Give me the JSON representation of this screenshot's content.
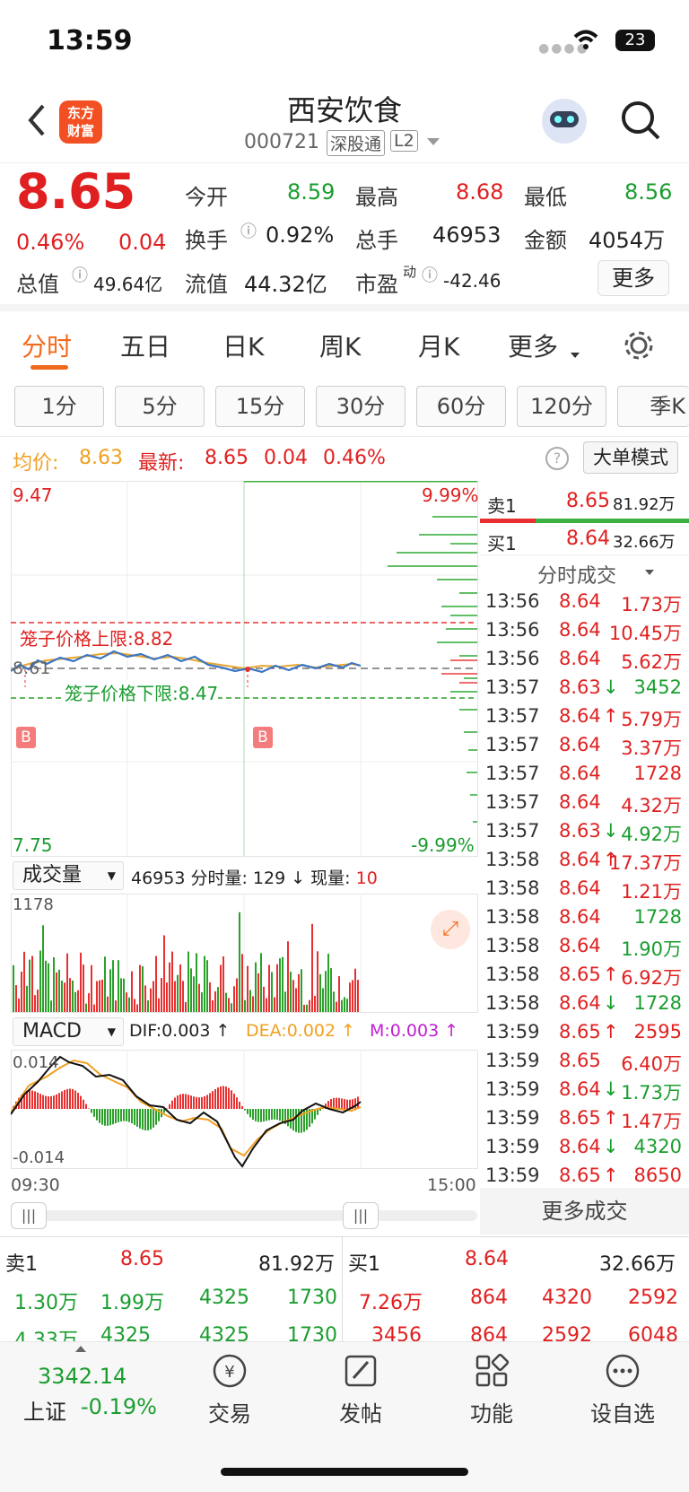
{
  "status": {
    "time": "13:59",
    "battery": "23"
  },
  "header": {
    "title": "西安饮食",
    "code": "000721",
    "tag1": "深股通",
    "tag2": "L2",
    "brand": "东方\n财富"
  },
  "quote": {
    "price": "8.65",
    "pct": "0.46%",
    "chg": "0.04",
    "open_l": "今开",
    "open": "8.59",
    "high_l": "最高",
    "high": "8.68",
    "low_l": "最低",
    "low": "8.56",
    "turn_l": "换手",
    "turn": "0.92%",
    "vol_l": "总手",
    "vol": "46953",
    "amt_l": "金额",
    "amt": "4054万",
    "mcap_l": "总值",
    "mcap": "49.64亿",
    "float_l": "流值",
    "float": "44.32亿",
    "pe_l": "市盈",
    "pe_sup": "动",
    "pe": "-42.46",
    "more": "更多"
  },
  "tabs": [
    "分时",
    "五日",
    "日K",
    "周K",
    "月K",
    "更多"
  ],
  "subtabs": [
    "1分",
    "5分",
    "15分",
    "30分",
    "60分",
    "120分",
    "季K"
  ],
  "info": {
    "avg_l": "均价:",
    "avg": "8.63",
    "new_l": "最新:",
    "new": "8.65",
    "chg": "0.04",
    "pct": "0.46%",
    "mode": "大单模式"
  },
  "chart": {
    "ymax": "9.47",
    "ymin": "7.75",
    "pmax": "9.99%",
    "pmin": "-9.99%",
    "upper": "笼子价格上限:8.82",
    "lower": "笼子价格下限:8.47",
    "ref": "8.61",
    "b": "B",
    "vol_sel": "成交量",
    "vol_info_a": "46953 分时量: 129 ↓ 现量:",
    "vol_info_b": "10",
    "vol_max": "1178",
    "macd_sel": "MACD",
    "dif": "DIF:0.003 ↑",
    "dea": "DEA:0.002 ↑",
    "m": "M:0.003 ↑",
    "mmax": "0.014",
    "mmin": "-0.014",
    "t0": "09:30",
    "t1": "15:00"
  },
  "side": {
    "sell1_l": "卖1",
    "sell1_p": "8.65",
    "sell1_v": "81.92万",
    "buy1_l": "买1",
    "buy1_p": "8.64",
    "buy1_v": "32.66万",
    "header": "分时成交",
    "more": "更多成交",
    "trades": [
      [
        "13:56",
        "8.64",
        "",
        "1.73万",
        "r"
      ],
      [
        "13:56",
        "8.64",
        "",
        "10.45万",
        "r"
      ],
      [
        "13:56",
        "8.64",
        "",
        "5.62万",
        "r"
      ],
      [
        "13:57",
        "8.63",
        "↓",
        "3452",
        "g"
      ],
      [
        "13:57",
        "8.64",
        "↑",
        "5.79万",
        "r"
      ],
      [
        "13:57",
        "8.64",
        "",
        "3.37万",
        "r"
      ],
      [
        "13:57",
        "8.64",
        "",
        "1728",
        "r"
      ],
      [
        "13:57",
        "8.64",
        "",
        "4.32万",
        "r"
      ],
      [
        "13:57",
        "8.63",
        "↓",
        "4.92万",
        "g"
      ],
      [
        "13:58",
        "8.64",
        "↑",
        "17.37万",
        "r"
      ],
      [
        "13:58",
        "8.64",
        "",
        "1.21万",
        "r"
      ],
      [
        "13:58",
        "8.64",
        "",
        "1728",
        "g"
      ],
      [
        "13:58",
        "8.64",
        "",
        "1.90万",
        "g"
      ],
      [
        "13:58",
        "8.65",
        "↑",
        "6.92万",
        "r"
      ],
      [
        "13:58",
        "8.64",
        "↓",
        "1728",
        "g"
      ],
      [
        "13:59",
        "8.65",
        "↑",
        "2595",
        "r"
      ],
      [
        "13:59",
        "8.65",
        "",
        "6.40万",
        "r"
      ],
      [
        "13:59",
        "8.64",
        "↓",
        "1.73万",
        "g"
      ],
      [
        "13:59",
        "8.65",
        "↑",
        "1.47万",
        "r"
      ],
      [
        "13:59",
        "8.64",
        "↓",
        "4320",
        "g"
      ],
      [
        "13:59",
        "8.65",
        "↑",
        "8650",
        "r"
      ]
    ]
  },
  "book": {
    "sell_l": "卖1",
    "sell_p": "8.65",
    "sell_v": "81.92万",
    "buy_l": "买1",
    "buy_p": "8.64",
    "buy_v": "32.66万",
    "s_r1": [
      "1.30万",
      "1.99万",
      "4325",
      "1730"
    ],
    "s_r2": [
      "4.33万",
      "4325",
      "4325",
      "1730"
    ],
    "b_r1": [
      "7.26万",
      "864",
      "4320",
      "2592"
    ],
    "b_r2": [
      "3456",
      "864",
      "2592",
      "6048"
    ]
  },
  "nav": {
    "index": "3342.14",
    "index_name": "上证",
    "index_pct": "-0.19%",
    "trade": "交易",
    "post": "发帖",
    "func": "功能",
    "watch": "设自选"
  }
}
